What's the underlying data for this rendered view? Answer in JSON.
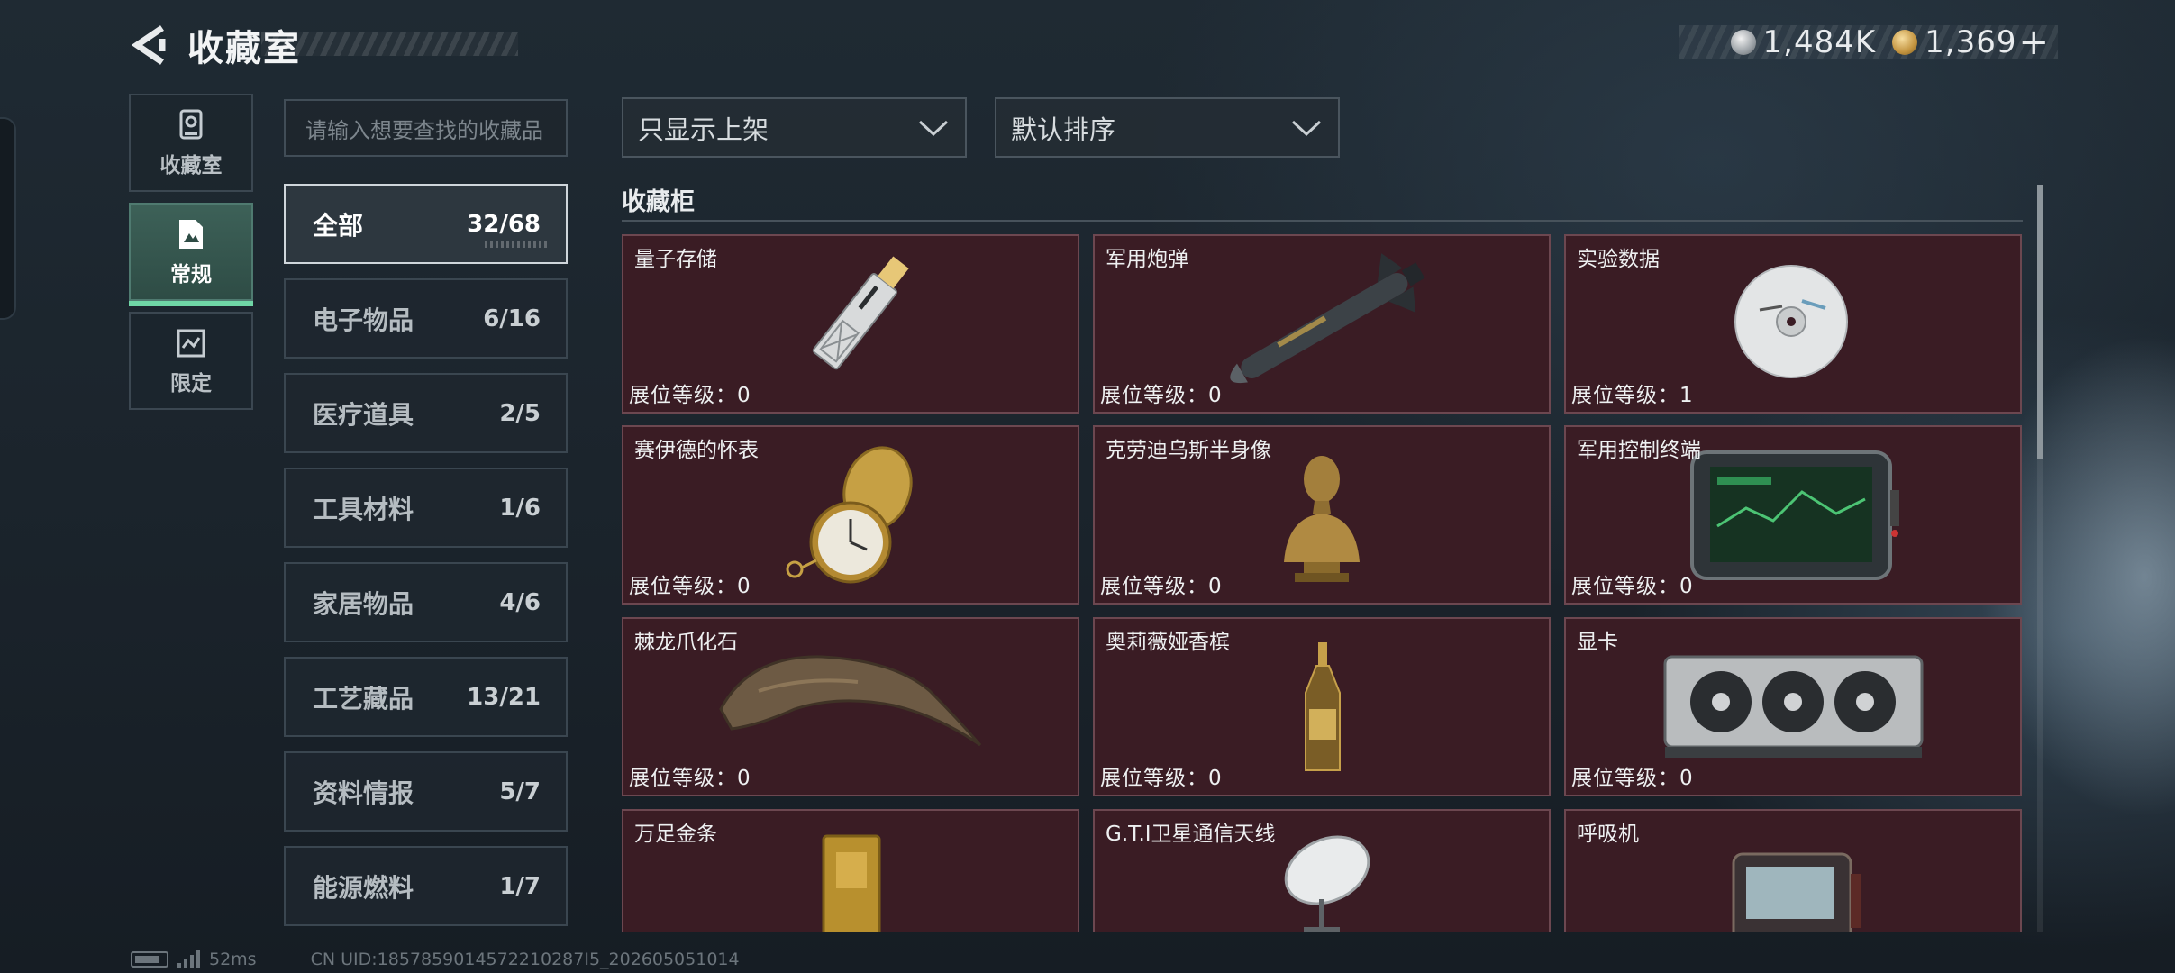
{
  "header": {
    "title": "收藏室",
    "back_icon": "back-arrow-icon"
  },
  "currency": [
    {
      "icon": "silver-coin-icon",
      "value": "1,484K"
    },
    {
      "icon": "gold-coin-icon",
      "value": "1,369",
      "plus": "+"
    }
  ],
  "side_tabs": [
    {
      "label": "收藏室",
      "icon": "trophy-icon",
      "active": false
    },
    {
      "label": "常规",
      "icon": "document-icon",
      "active": true
    },
    {
      "label": "限定",
      "icon": "limited-icon",
      "active": false
    }
  ],
  "search": {
    "placeholder": "请输入想要查找的收藏品"
  },
  "categories": [
    {
      "name": "全部",
      "count": "32/68",
      "active": true
    },
    {
      "name": "电子物品",
      "count": "6/16"
    },
    {
      "name": "医疗道具",
      "count": "2/5"
    },
    {
      "name": "工具材料",
      "count": "1/6"
    },
    {
      "name": "家居物品",
      "count": "4/6"
    },
    {
      "name": "工艺藏品",
      "count": "13/21"
    },
    {
      "name": "资料情报",
      "count": "5/7"
    },
    {
      "name": "能源燃料",
      "count": "1/7"
    }
  ],
  "filters": {
    "display_filter": "只显示上架",
    "sort": "默认排序"
  },
  "cabinet": {
    "title": "收藏柜",
    "level_label": "展位等级：",
    "items": [
      {
        "name": "量子存储",
        "level": "0",
        "icon": "usb-drive-icon"
      },
      {
        "name": "军用炮弹",
        "level": "0",
        "icon": "missile-icon"
      },
      {
        "name": "实验数据",
        "level": "1",
        "icon": "disc-icon"
      },
      {
        "name": "赛伊德的怀表",
        "level": "0",
        "icon": "pocket-watch-icon"
      },
      {
        "name": "克劳迪乌斯半身像",
        "level": "0",
        "icon": "bust-icon"
      },
      {
        "name": "军用控制终端",
        "level": "0",
        "icon": "control-terminal-icon"
      },
      {
        "name": "棘龙爪化石",
        "level": "0",
        "icon": "claw-fossil-icon"
      },
      {
        "name": "奥莉薇娅香槟",
        "level": "0",
        "icon": "champagne-icon"
      },
      {
        "name": "显卡",
        "level": "0",
        "icon": "graphics-card-icon"
      },
      {
        "name": "万足金条",
        "level": "",
        "icon": "gold-bar-icon"
      },
      {
        "name": "G.T.I卫星通信天线",
        "level": "",
        "icon": "satellite-dish-icon"
      },
      {
        "name": "呼吸机",
        "level": "",
        "icon": "ventilator-icon"
      }
    ]
  },
  "footer": {
    "ping": "52ms",
    "uid": "CN UID:1857859014572210287I5_202605051014"
  },
  "colors": {
    "accent_green": "#6fd6a6",
    "card_bg": "#3a1c24",
    "card_border": "#6c4750"
  }
}
